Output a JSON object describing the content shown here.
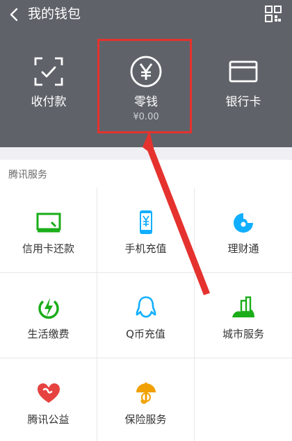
{
  "topbar": {
    "title": "我的钱包",
    "back_icon": "chevron-left-icon",
    "menu_icon": "grid-icon"
  },
  "header_items": [
    {
      "label": "收付款",
      "icon": "scan-check-icon"
    },
    {
      "label": "零钱",
      "amount": "¥0.00",
      "icon": "yen-circle-icon"
    },
    {
      "label": "银行卡",
      "icon": "bank-card-icon"
    }
  ],
  "section": {
    "title": "腾讯服务",
    "items": [
      {
        "label": "信用卡还款",
        "icon": "credit-card-icon"
      },
      {
        "label": "手机充值",
        "icon": "phone-topup-icon"
      },
      {
        "label": "理财通",
        "icon": "wealth-icon"
      },
      {
        "label": "生活缴费",
        "icon": "lightning-icon"
      },
      {
        "label": "Q币充值",
        "icon": "penguin-icon"
      },
      {
        "label": "城市服务",
        "icon": "city-icon"
      },
      {
        "label": "腾讯公益",
        "icon": "heart-icon"
      },
      {
        "label": "保险服务",
        "icon": "umbrella-icon"
      }
    ]
  },
  "colors": {
    "header_bg": "#5f6369",
    "highlight": "#e5322e",
    "green": "#1aad19",
    "blue": "#10aeff",
    "orange": "#f0a000",
    "pink": "#e64340"
  }
}
